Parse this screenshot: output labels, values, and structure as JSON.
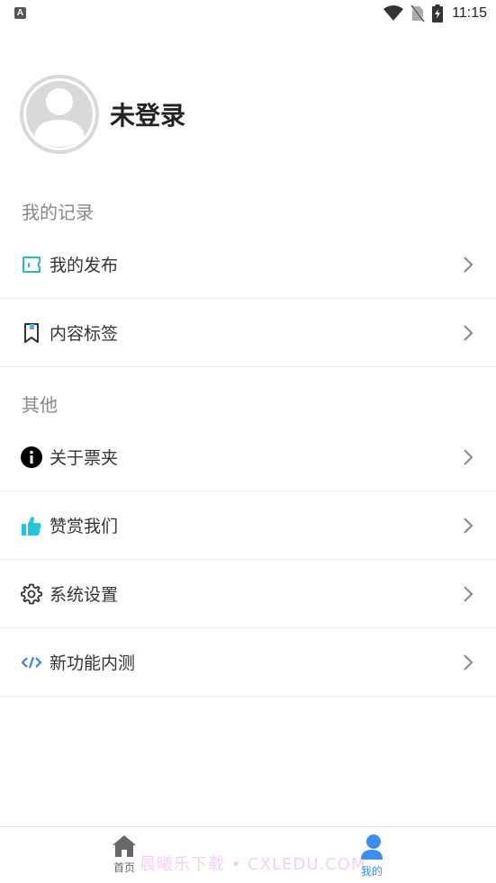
{
  "status_bar": {
    "left_icon_letter": "A",
    "time": "11:15"
  },
  "profile": {
    "name": "未登录"
  },
  "sections": [
    {
      "title": "我的记录",
      "items": [
        {
          "label": "我的发布",
          "icon": "ticket-icon",
          "icon_color": "#2bbfa4"
        },
        {
          "label": "内容标签",
          "icon": "bookmark-icon",
          "icon_color": "#333333"
        }
      ]
    },
    {
      "title": "其他",
      "items": [
        {
          "label": "关于票夹",
          "icon": "info-icon",
          "icon_color": "#000000"
        },
        {
          "label": "赞赏我们",
          "icon": "thumbs-up-icon",
          "icon_color": "#27c4d9"
        },
        {
          "label": "系统设置",
          "icon": "gear-icon",
          "icon_color": "#333333"
        },
        {
          "label": "新功能内测",
          "icon": "code-icon",
          "icon_color": "#3d7ff5"
        }
      ]
    }
  ],
  "bottom_nav": {
    "items": [
      {
        "label": "首页",
        "icon": "home-icon",
        "active": false
      },
      {
        "label": "我的",
        "icon": "profile-icon",
        "active": true
      }
    ],
    "active_color": "#3d8ef0",
    "inactive_color": "#666666"
  },
  "watermark": "晨曦乐下载 • CXLEDU.COM"
}
